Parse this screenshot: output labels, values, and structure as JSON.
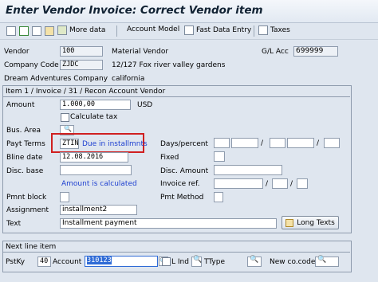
{
  "window": {
    "title": "Enter Vendor Invoice: Correct Vendor item"
  },
  "toolbar": {
    "more_data": "More data",
    "account_model": "Account Model",
    "fast_data_entry": "Fast Data Entry",
    "taxes": "Taxes"
  },
  "header": {
    "vendor_label": "Vendor",
    "vendor_value": "100",
    "vendor_name": "Material Vendor",
    "gl_acc_label": "G/L Acc",
    "gl_acc_value": "699999",
    "company_code_label": "Company Code",
    "company_code_value": "ZJDC",
    "address": "12/127 Fox river valley gardens",
    "company_name": "Dream Adventures Company",
    "city": "california"
  },
  "item": {
    "heading": "Item 1 / Invoice / 31 / Recon Account Vendor",
    "amount_label": "Amount",
    "amount_value": "1.000,00",
    "currency": "USD",
    "calc_tax_label": "Calculate tax",
    "bus_area_label": "Bus. Area",
    "payt_terms_label": "Payt Terms",
    "payt_terms_value": "ZTIN",
    "payt_terms_desc": "Due in installmnts",
    "days_percent_label": "Days/percent",
    "slash": "/",
    "bline_date_label": "Bline date",
    "bline_date_value": "12.08.2016",
    "fixed_label": "Fixed",
    "disc_base_label": "Disc. base",
    "disc_amount_label": "Disc. Amount",
    "amount_calculated": "Amount is calculated",
    "invoice_ref_label": "Invoice ref.",
    "pmnt_block_label": "Pmnt block",
    "pmt_method_label": "Pmt Method",
    "assignment_label": "Assignment",
    "assignment_value": "installment2",
    "text_label": "Text",
    "text_value": "Installment payment",
    "long_texts_label": "Long Texts"
  },
  "next_line": {
    "heading": "Next line item",
    "pstky_label": "PstKy",
    "pstky_value": "40",
    "account_label": "Account",
    "account_value": "310123",
    "l_ind_label": "L Ind",
    "ttype_label": "TType",
    "new_cocode_label": "New co.code"
  },
  "colors": {
    "highlight": "#d02020",
    "link_blue": "#1d3fd0",
    "selection": "#2f6bd6"
  }
}
